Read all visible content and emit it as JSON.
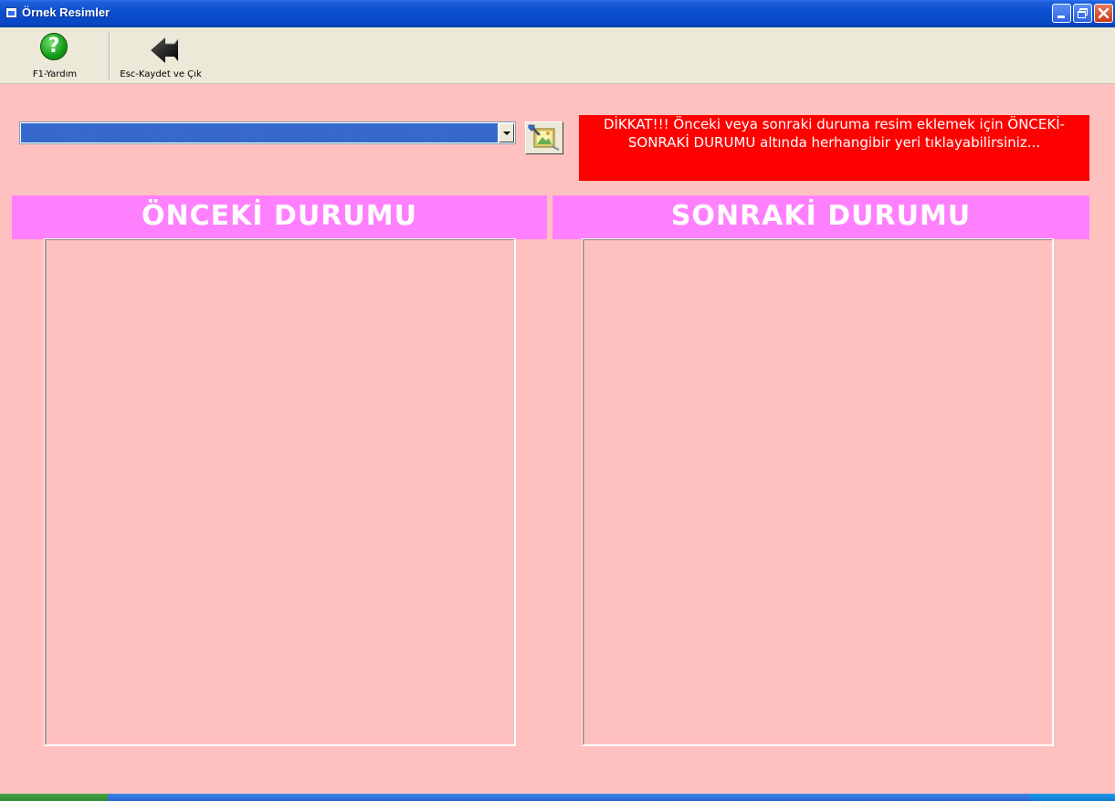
{
  "window": {
    "title": "Örnek Resimler"
  },
  "toolbar": {
    "help_label": "F1-Yardım",
    "exit_label": "Esc-Kaydet ve Çık"
  },
  "selector": {
    "value": ""
  },
  "warning": {
    "text": "DİKKAT!!! Önceki veya sonraki duruma resim eklemek için ÖNCEKİ-SONRAKİ DURUMU altında herhangibir yeri tıklayabilirsiniz..."
  },
  "panels": {
    "before_title": "ÖNCEKİ DURUMU",
    "after_title": "SONRAKİ DURUMU"
  },
  "colors": {
    "background": "#ffc0c0",
    "panel_header": "#ff80ff",
    "warning_bg": "#ff0000"
  },
  "icons": {
    "help": "help-question-icon",
    "exit": "back-arrow-icon",
    "pick": "image-tool-icon"
  }
}
